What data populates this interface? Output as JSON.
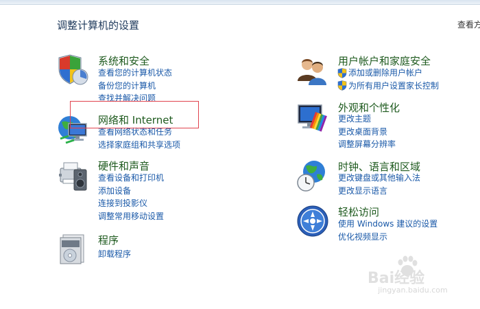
{
  "page": {
    "title": "调整计算机的设置",
    "view_by": "查看方"
  },
  "categories": {
    "system_security": {
      "title": "系统和安全",
      "links": [
        "查看您的计算机状态",
        "备份您的计算机",
        "查找并解决问题"
      ]
    },
    "network_internet": {
      "title": "网络和 Internet",
      "links": [
        "查看网络状态和任务",
        "选择家庭组和共享选项"
      ]
    },
    "hardware_sound": {
      "title": "硬件和声音",
      "links": [
        "查看设备和打印机",
        "添加设备",
        "连接到投影仪",
        "调整常用移动设置"
      ]
    },
    "programs": {
      "title": "程序",
      "links": [
        "卸载程序"
      ]
    },
    "user_accounts": {
      "title": "用户帐户和家庭安全",
      "links": [
        "添加或删除用户帐户",
        "为所有用户设置家长控制"
      ]
    },
    "appearance": {
      "title": "外观和个性化",
      "links": [
        "更改主题",
        "更改桌面背景",
        "调整屏幕分辨率"
      ]
    },
    "clock_region": {
      "title": "时钟、语言和区域",
      "links": [
        "更改键盘或其他输入法",
        "更改显示语言"
      ]
    },
    "ease_access": {
      "title": "轻松访问",
      "links": [
        "使用 Windows 建议的设置",
        "优化视频显示"
      ]
    }
  },
  "watermark": {
    "logo_text": "Bai经验",
    "url_text": "jingyan.baidu.com"
  },
  "colors": {
    "link": "#1a59a8",
    "category_title": "#1e5a1e",
    "highlight": "#e0424d"
  }
}
